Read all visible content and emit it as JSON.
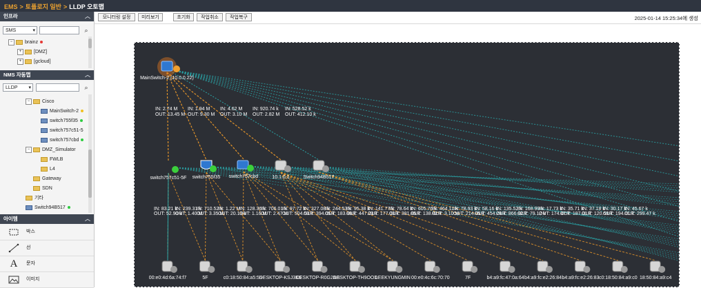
{
  "breadcrumb": {
    "root": "EMS",
    "sep": ">",
    "middle": "토폴로지 일반",
    "current": "LLDP 오토맵"
  },
  "sidebar": {
    "infra": {
      "title": "인프라",
      "filter": "SMS",
      "tree": [
        {
          "label": "brainz",
          "status": "#e53935"
        },
        {
          "label": "[DMZ]"
        },
        {
          "label": "[gcloud]"
        }
      ]
    },
    "nms": {
      "title": "NMS 자동맵",
      "filter": "LLDP",
      "tree": [
        {
          "label": "Cisco"
        },
        {
          "label": "MainSwitch-2",
          "status": "#f0c020"
        },
        {
          "label": "switch755f35",
          "status": "#2ecc40"
        },
        {
          "label": "switch757c51-5",
          "status": "#2ecc40"
        },
        {
          "label": "switch757cbd",
          "status": "#2ecc40"
        },
        {
          "label": "DMZ_Simulator"
        },
        {
          "label": "FWLB"
        },
        {
          "label": "L4"
        },
        {
          "label": "Gateway"
        },
        {
          "label": "SDN"
        },
        {
          "label": "기타"
        },
        {
          "label": "Switch94B517",
          "status": "#2ecc40"
        }
      ]
    },
    "items": {
      "title": "아이템",
      "tools": [
        {
          "label": "박스",
          "icon": "box-icon"
        },
        {
          "label": "선",
          "icon": "line-icon"
        },
        {
          "label": "문자",
          "icon": "text-icon"
        },
        {
          "label": "이미지",
          "icon": "image-icon"
        }
      ]
    }
  },
  "toolbar": {
    "buttons": [
      "모니터링 설정",
      "미리보기",
      "초기화",
      "작업취소",
      "작업복구"
    ],
    "timestamp": "2025-01-14 15:25:34에 생성"
  },
  "map": {
    "main": {
      "label": "MainSwitch-2 (10.0.0.22)"
    },
    "top_edge_labels": [
      {
        "in": "IN: 2.74 M",
        "out": "OUT: 13.45 M"
      },
      {
        "in": "IN: 1.94 M",
        "out": "OUT: 9.30 M"
      },
      {
        "in": "IN: 4.62 M",
        "out": "OUT: 3.10 M"
      },
      {
        "in": "IN: 920.74 k",
        "out": "OUT: 2.82 M"
      },
      {
        "in": "IN: 528.52 k",
        "out": "OUT: 412.10 k"
      }
    ],
    "mid_nodes": [
      {
        "label": "switch757c51-5F"
      },
      {
        "label": "switch755f35"
      },
      {
        "label": "switch757cbd"
      },
      {
        "label": "10.1.0.1"
      },
      {
        "label": "Switch94B517"
      }
    ],
    "mid_edge_labels": [
      {
        "in": "IN: 83.21 k",
        "out": "OUT: 52.90 k"
      },
      {
        "in": "IN: 239.31 k",
        "out": "OUT: 1.40 M"
      },
      {
        "in": "IN: 710.52 k",
        "out": "OUT: 3.35 M"
      },
      {
        "in": "IN: 1.22 M",
        "out": "OUT: 20.13 k"
      },
      {
        "in": "IN: 128.36 k",
        "out": "OUT: 1.16 M"
      },
      {
        "in": "IN: 706.01 k",
        "out": "OUT: 2.47 M"
      },
      {
        "in": "IN: 97.72 k",
        "out": "OUT: 504.53 k"
      },
      {
        "in": "IN: 327.08 k",
        "out": "OUT: 394.05 k"
      },
      {
        "in": "IN: 244.53 k",
        "out": "OUT: 183.99 k"
      },
      {
        "in": "IN: 95.38 k",
        "out": "OUT: 447.23 k"
      },
      {
        "in": "IN: 141.77 k",
        "out": "OUT: 177.03 k"
      },
      {
        "in": "IN: 78.64 k",
        "out": "OUT: 381.85 k"
      },
      {
        "in": "IN: 605.76 k",
        "out": "OUT: 138.82 k"
      },
      {
        "in": "IN: 464.11 k",
        "out": "OUT: 3.10 M"
      },
      {
        "in": "IN: 78.93 k",
        "out": "OUT: 214.05 k"
      },
      {
        "in": "IN: 58.16 k",
        "out": "OUT: 454.29 k"
      },
      {
        "in": "IN: 135.52 k",
        "out": "OUT: 866.92 k"
      },
      {
        "in": "IN: 168.99 k",
        "out": "OUT: 79.12 k"
      },
      {
        "in": "IN: 17.73 k",
        "out": "OUT: 174.47 k"
      },
      {
        "in": "IN: 35.71 k",
        "out": "OUT: 187.01 k"
      },
      {
        "in": "IN: 37.18 k",
        "out": "OUT: 120.53 k"
      },
      {
        "in": "IN: 30.17 k",
        "out": "OUT: 194.01 k"
      },
      {
        "in": "IN: 45.67 k",
        "out": "OUT: 299.47 k"
      }
    ],
    "bottom_nodes": [
      {
        "label": "00:e0:4d:6a:74:f7"
      },
      {
        "label": "5F"
      },
      {
        "label": "c0:18:50:84:a5:55"
      },
      {
        "label": "DESKTOP-KSJ3K6"
      },
      {
        "label": "DESKTOP-R0G2AB"
      },
      {
        "label": "DESKTOP-TH9OOD"
      },
      {
        "label": "LEEKYUNGMIN"
      },
      {
        "label": "00:e0:4c:6c:70:70"
      },
      {
        "label": "7F"
      },
      {
        "label": "b4:a9:fc:47:0a:64"
      },
      {
        "label": "b4:a9:fc:e2:26:84"
      },
      {
        "label": "b4:a9:fc:e2:26:83"
      },
      {
        "label": "c0:18:50:84:a9:c0"
      },
      {
        "label": "18:50:84:a9:c4"
      }
    ],
    "colors": {
      "orange_link": "#e0922a",
      "teal_link": "#2aa5a8",
      "up_green": "#3ccf3c",
      "canvas_bg": "#2c2f35"
    }
  }
}
